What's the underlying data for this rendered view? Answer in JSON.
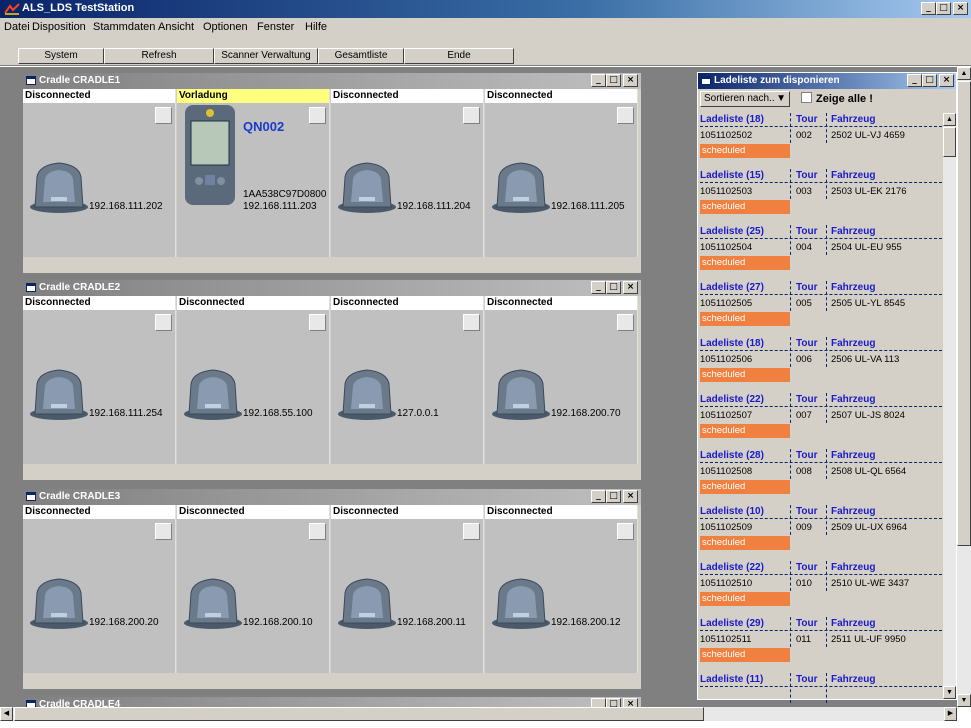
{
  "app": {
    "title": "ALS_LDS TestStation"
  },
  "menu": [
    "Datei",
    "Disposition",
    "Stammdaten",
    "Ansicht",
    "Optionen",
    "Fenster",
    "Hilfe"
  ],
  "toolbar": [
    "System",
    "Refresh",
    "Scanner Verwaltung",
    "Gesamtliste",
    "Ende"
  ],
  "cradles": [
    {
      "title": "Cradle CRADLE1",
      "slots": [
        {
          "status": "Disconnected",
          "ip": "192.168.111.202"
        },
        {
          "status": "Vorladung",
          "device": "QN002",
          "serial": "1AA538C97D0800",
          "ip": "192.168.111.203"
        },
        {
          "status": "Disconnected",
          "ip": "192.168.111.204"
        },
        {
          "status": "Disconnected",
          "ip": "192.168.111.205"
        }
      ]
    },
    {
      "title": "Cradle CRADLE2",
      "slots": [
        {
          "status": "Disconnected",
          "ip": "192.168.111.254"
        },
        {
          "status": "Disconnected",
          "ip": "192.168.55.100"
        },
        {
          "status": "Disconnected",
          "ip": "127.0.0.1"
        },
        {
          "status": "Disconnected",
          "ip": "192.168.200.70"
        }
      ]
    },
    {
      "title": "Cradle CRADLE3",
      "slots": [
        {
          "status": "Disconnected",
          "ip": "192.168.200.20"
        },
        {
          "status": "Disconnected",
          "ip": "192.168.200.10"
        },
        {
          "status": "Disconnected",
          "ip": "192.168.200.11"
        },
        {
          "status": "Disconnected",
          "ip": "192.168.200.12"
        }
      ]
    },
    {
      "title": "Cradle CRADLE4",
      "slots": []
    }
  ],
  "ladeliste": {
    "title": "Ladeliste zum disponieren",
    "sort_label": "Sortieren nach..",
    "show_all": "Zeige alle !",
    "col_tour": "Tour",
    "col_fahrzeug": "Fahrzeug",
    "entries": [
      {
        "name": "Ladeliste (18)",
        "id": "1051102502",
        "tour": "002",
        "fahrzeug": "2502 UL-VJ 4659",
        "status": "scheduled"
      },
      {
        "name": "Ladeliste (15)",
        "id": "1051102503",
        "tour": "003",
        "fahrzeug": "2503 UL-EK 2176",
        "status": "scheduled"
      },
      {
        "name": "Ladeliste (25)",
        "id": "1051102504",
        "tour": "004",
        "fahrzeug": "2504 UL-EU 955",
        "status": "scheduled"
      },
      {
        "name": "Ladeliste (27)",
        "id": "1051102505",
        "tour": "005",
        "fahrzeug": "2505 UL-YL 8545",
        "status": "scheduled"
      },
      {
        "name": "Ladeliste (18)",
        "id": "1051102506",
        "tour": "006",
        "fahrzeug": "2506 UL-VA 113",
        "status": "scheduled"
      },
      {
        "name": "Ladeliste (22)",
        "id": "1051102507",
        "tour": "007",
        "fahrzeug": "2507 UL-JS 8024",
        "status": "scheduled"
      },
      {
        "name": "Ladeliste (28)",
        "id": "1051102508",
        "tour": "008",
        "fahrzeug": "2508 UL-QL 6564",
        "status": "scheduled"
      },
      {
        "name": "Ladeliste (10)",
        "id": "1051102509",
        "tour": "009",
        "fahrzeug": "2509 UL-UX 6964",
        "status": "scheduled"
      },
      {
        "name": "Ladeliste (22)",
        "id": "1051102510",
        "tour": "010",
        "fahrzeug": "2510 UL-WE 3437",
        "status": "scheduled"
      },
      {
        "name": "Ladeliste (29)",
        "id": "1051102511",
        "tour": "011",
        "fahrzeug": "2511 UL-UF 9950",
        "status": "scheduled"
      },
      {
        "name": "Ladeliste (11)",
        "id": "",
        "tour": "",
        "fahrzeug": "",
        "status": ""
      }
    ]
  },
  "window_buttons": {
    "minimize": "_",
    "maximize": "□",
    "close": "×"
  }
}
